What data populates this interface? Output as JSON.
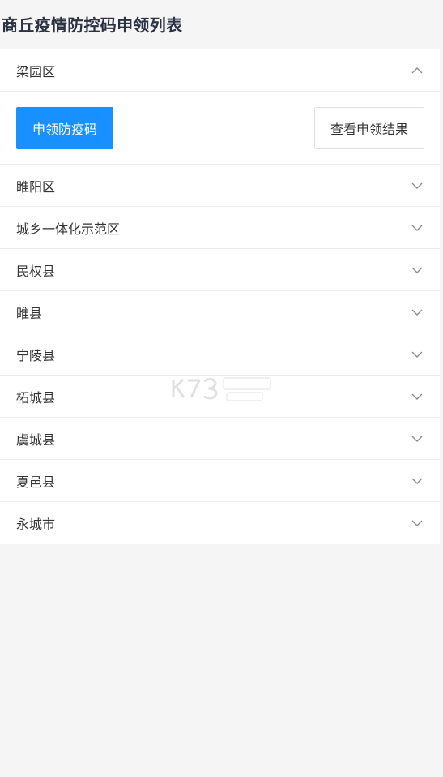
{
  "page": {
    "title": "商丘疫情防控码申领列表"
  },
  "districts": [
    {
      "label": "梁园区",
      "expanded": true
    },
    {
      "label": "睢阳区",
      "expanded": false
    },
    {
      "label": "城乡一体化示范区",
      "expanded": false
    },
    {
      "label": "民权县",
      "expanded": false
    },
    {
      "label": "睢县",
      "expanded": false
    },
    {
      "label": "宁陵县",
      "expanded": false
    },
    {
      "label": "柘城县",
      "expanded": false
    },
    {
      "label": "虞城县",
      "expanded": false
    },
    {
      "label": "夏邑县",
      "expanded": false
    },
    {
      "label": "永城市",
      "expanded": false
    }
  ],
  "actions": {
    "apply_label": "申领防疫码",
    "view_result_label": "查看申领结果"
  },
  "icons": {
    "expanded": "chevron-up-icon",
    "collapsed": "chevron-down-icon"
  },
  "colors": {
    "primary": "#1890ff",
    "background": "#f5f5f5",
    "panel": "#ffffff"
  }
}
